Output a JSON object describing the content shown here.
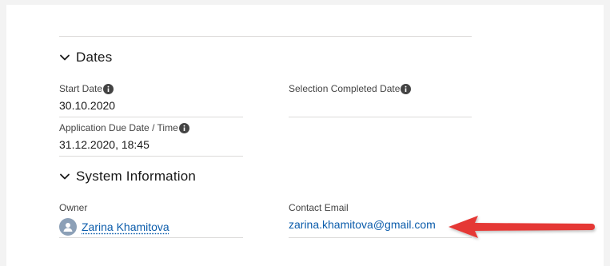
{
  "sections": {
    "dates": {
      "title": "Dates",
      "start_date": {
        "label": "Start Date",
        "value": "30.10.2020"
      },
      "selection_completed_date": {
        "label": "Selection Completed Date",
        "value": ""
      },
      "application_due": {
        "label": "Application Due Date / Time",
        "value": "31.12.2020, 18:45"
      }
    },
    "system_information": {
      "title": "System Information",
      "owner": {
        "label": "Owner",
        "value": "Zarina Khamitova"
      },
      "contact_email": {
        "label": "Contact Email",
        "value": "zarina.khamitova@gmail.com"
      }
    }
  },
  "colors": {
    "link": "#0b5cab",
    "annotation_arrow": "#e53935",
    "info_icon": "#444444"
  },
  "icons": [
    "chevron-down-icon",
    "info-icon",
    "user-avatar-icon",
    "arrow-annotation"
  ]
}
